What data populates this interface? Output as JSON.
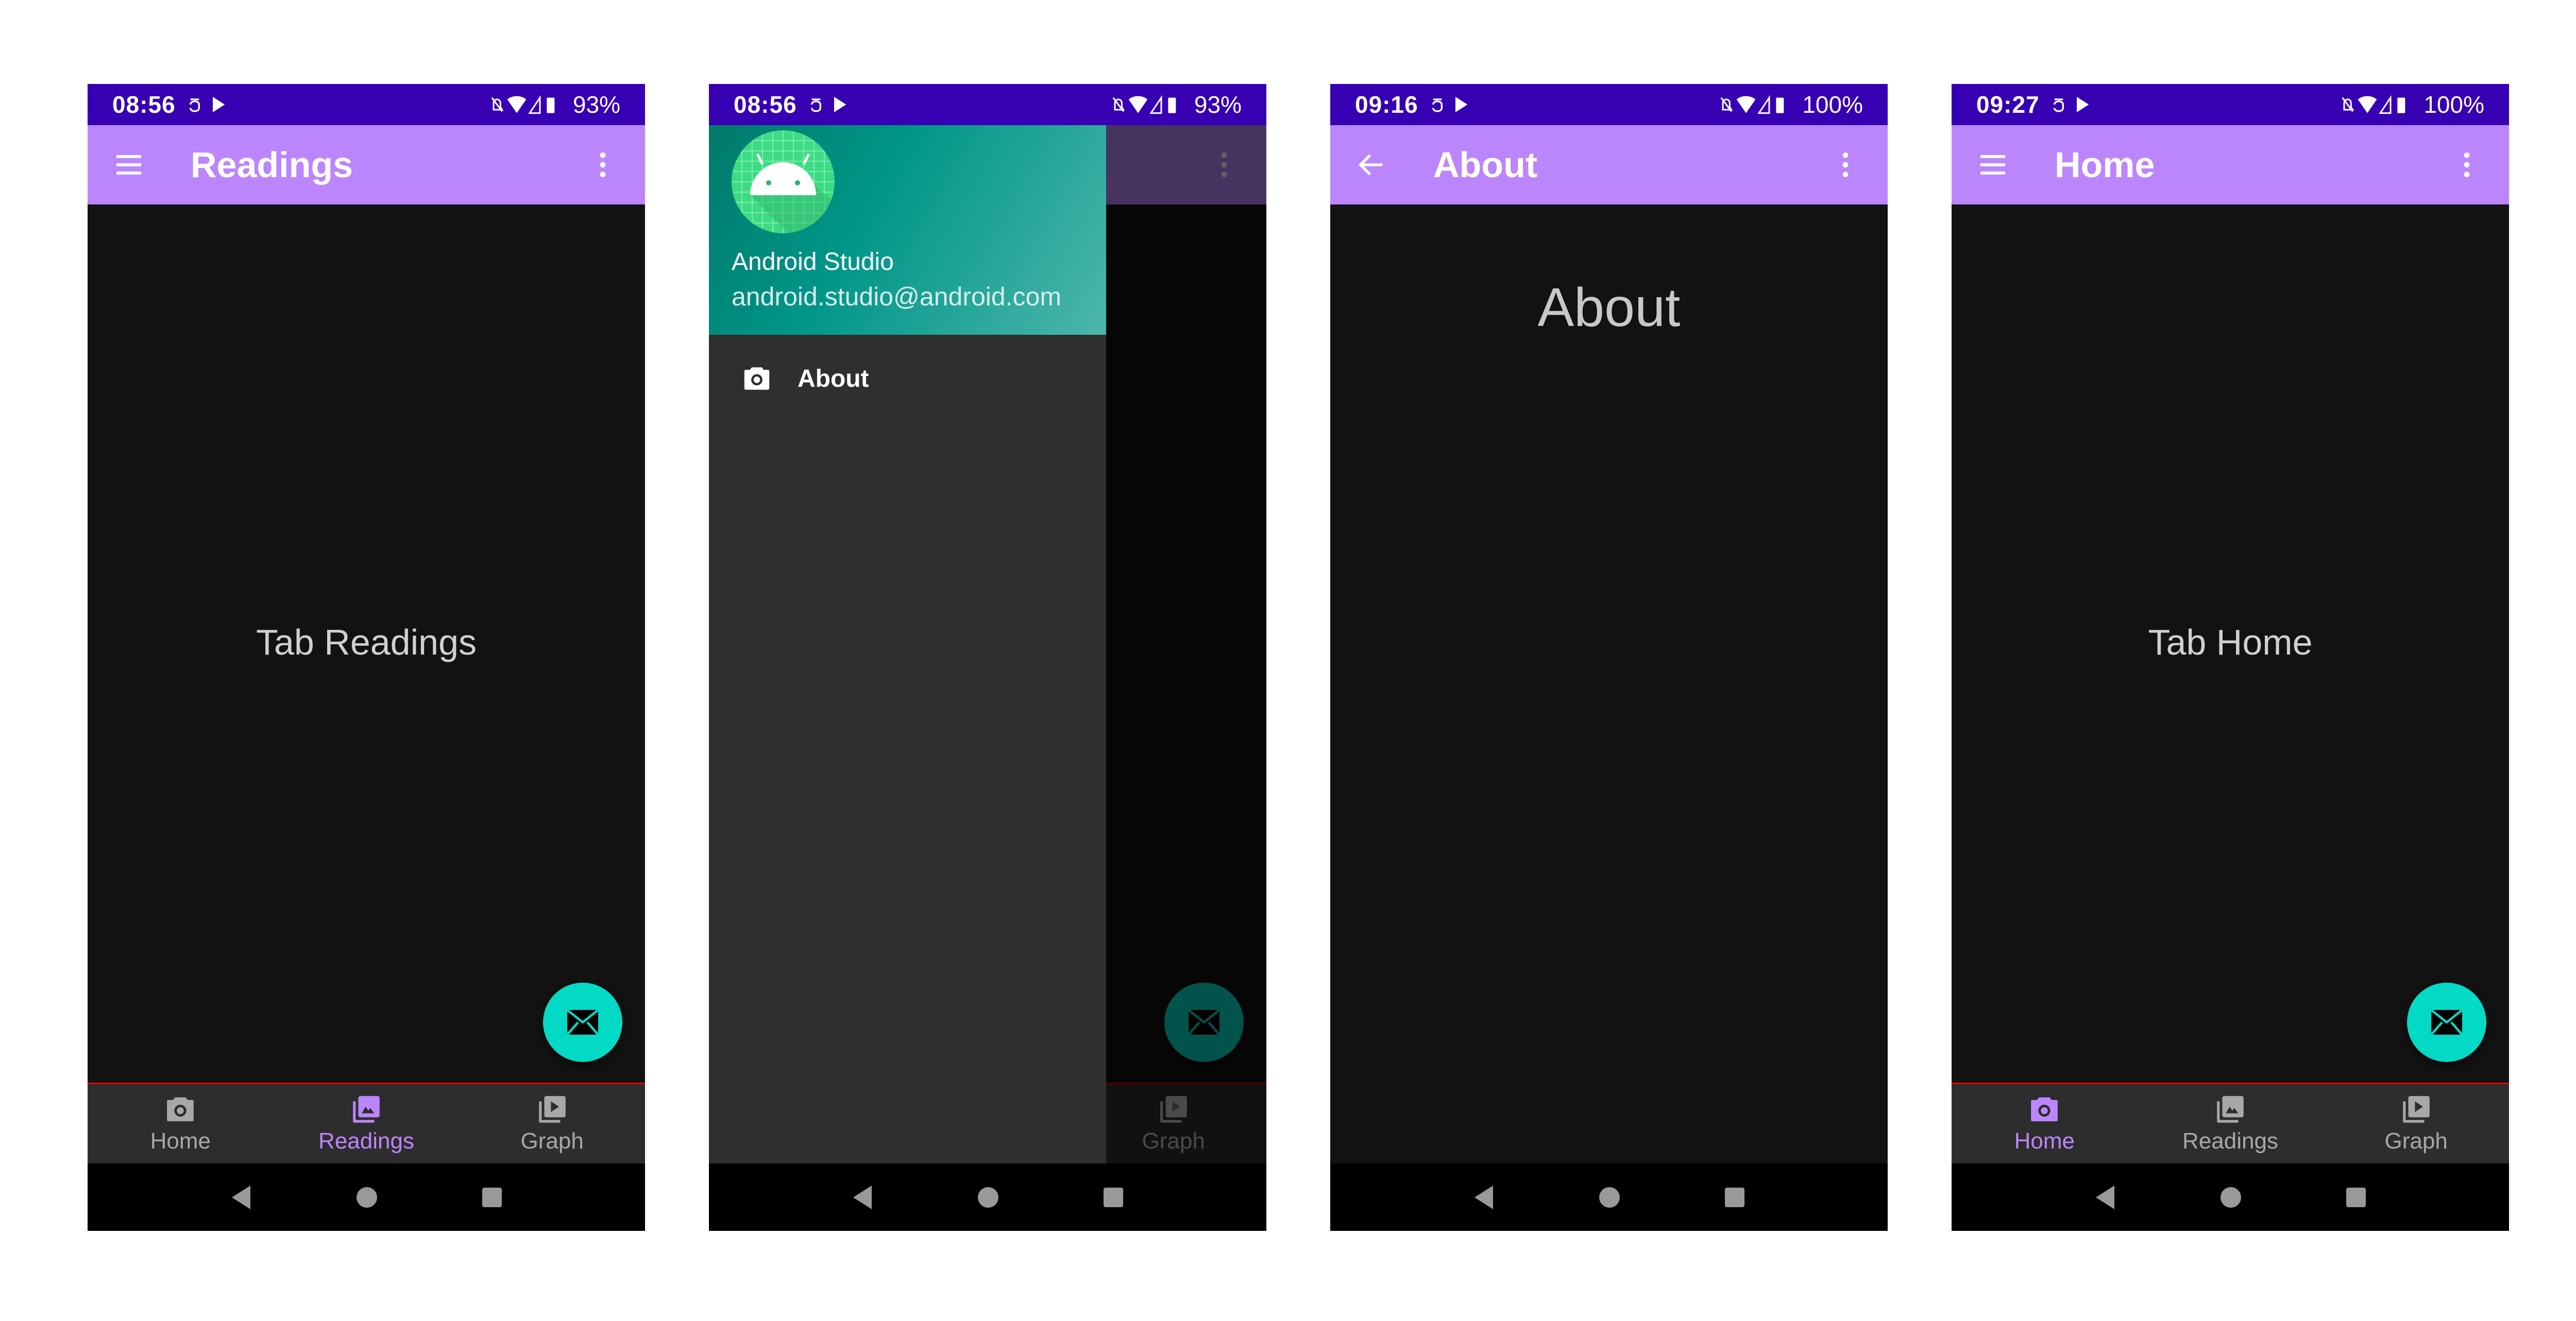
{
  "colors": {
    "status_bar": "#3700b3",
    "app_bar": "#bb86fc",
    "background": "#121212",
    "fab": "#03dac5",
    "active_tab": "#bb86fc",
    "inactive_tab": "#a8a8a8",
    "drawer_header": "#009688"
  },
  "screens": [
    {
      "status": {
        "time": "08:56",
        "battery": "93%"
      },
      "appbar": {
        "title": "Readings",
        "nav_icon": "menu-icon"
      },
      "content_text": "Tab Readings",
      "bottom_nav": [
        {
          "label": "Home",
          "icon": "camera-icon"
        },
        {
          "label": "Readings",
          "icon": "photo-library-icon",
          "active": true
        },
        {
          "label": "Graph",
          "icon": "video-library-icon"
        }
      ]
    },
    {
      "status": {
        "time": "08:56",
        "battery": "93%"
      },
      "drawer": {
        "name": "Android Studio",
        "email": "android.studio@android.com",
        "items": [
          {
            "label": "About",
            "icon": "camera-icon"
          }
        ]
      },
      "bottom_nav": [
        {
          "label": "Graph",
          "icon": "video-library-icon"
        }
      ]
    },
    {
      "status": {
        "time": "09:16",
        "battery": "100%"
      },
      "appbar": {
        "title": "About",
        "nav_icon": "arrow-back-icon"
      },
      "content_text": "About"
    },
    {
      "status": {
        "time": "09:27",
        "battery": "100%"
      },
      "appbar": {
        "title": "Home",
        "nav_icon": "menu-icon"
      },
      "content_text": "Tab Home",
      "bottom_nav": [
        {
          "label": "Home",
          "icon": "camera-icon",
          "active": true
        },
        {
          "label": "Readings",
          "icon": "photo-library-icon"
        },
        {
          "label": "Graph",
          "icon": "video-library-icon"
        }
      ]
    }
  ]
}
